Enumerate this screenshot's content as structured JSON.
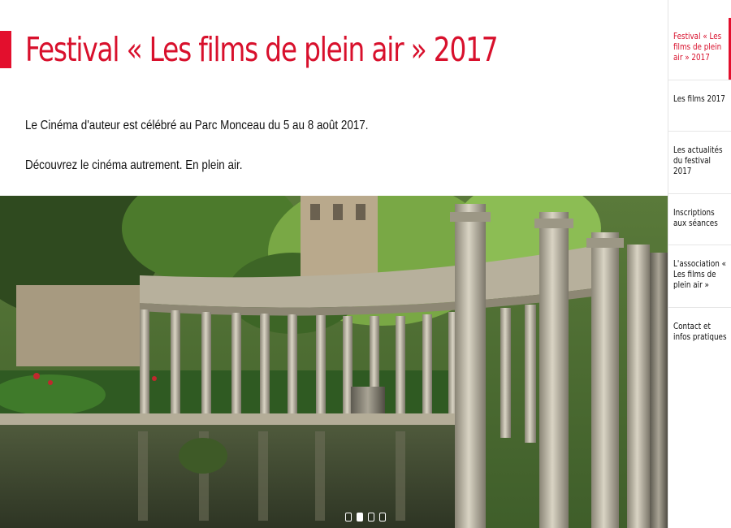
{
  "header": {
    "title": "Festival « Les films de plein air » 2017",
    "intro_line_1": "Le Cinéma d'auteur est célébré au Parc Monceau du 5 au 8 août 2017.",
    "intro_line_2": "Découvrez le cinéma autrement. En plein air."
  },
  "slideshow": {
    "slide_count": 4,
    "active_slide": 2
  },
  "sidebar": {
    "items": [
      {
        "label": "Festival « Les films de plein air » 2017",
        "active": true
      },
      {
        "label": "Les films 2017",
        "active": false
      },
      {
        "label": "Les actualités du festival 2017",
        "active": false
      },
      {
        "label": "Inscriptions aux séances",
        "active": false
      },
      {
        "label": "L'association « Les films de plein air »",
        "active": false
      },
      {
        "label": "Contact et infos pratiques",
        "active": false
      }
    ]
  },
  "colors": {
    "accent": "#e30f2d",
    "title": "#d8102c"
  }
}
